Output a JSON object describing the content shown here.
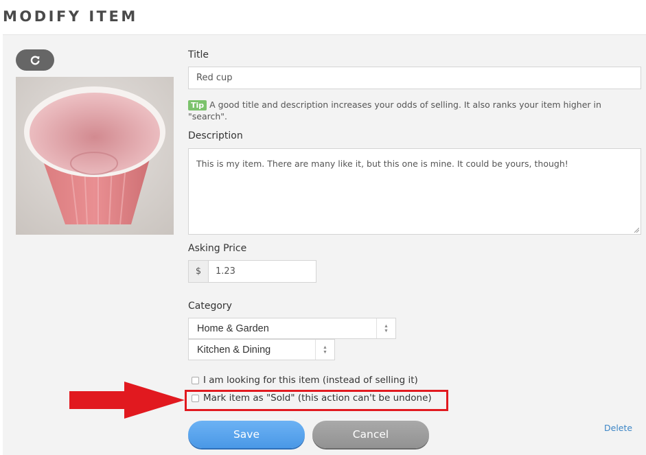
{
  "header": {
    "title": "MODIFY ITEM"
  },
  "photo": {
    "alt": "Red cup photo"
  },
  "form": {
    "title_label": "Title",
    "title_value": "Red cup",
    "tip_badge": "Tip",
    "tip_text": "A good title and description increases your odds of selling. It also ranks your item higher in \"search\".",
    "description_label": "Description",
    "description_value": "This is my item.  There are many like it, but this one is mine.  It could be yours, though!",
    "price_label": "Asking Price",
    "price_currency": "$",
    "price_value": "1.23",
    "category_label": "Category",
    "category_primary": "Home & Garden",
    "category_secondary": "Kitchen & Dining",
    "looking_label": "I am looking for this item (instead of selling it)",
    "sold_label": "Mark item as \"Sold\" (this action can't be undone)"
  },
  "actions": {
    "save_label": "Save",
    "cancel_label": "Cancel",
    "delete_label": "Delete"
  },
  "colors": {
    "save": "#4a98e6",
    "cancel": "#929292",
    "highlight": "#e1191f",
    "tip_badge": "#7bc26c",
    "link": "#3d86c6"
  },
  "icons": {
    "rotate": "rotate-icon",
    "annotation_arrow": "red-arrow-icon"
  }
}
